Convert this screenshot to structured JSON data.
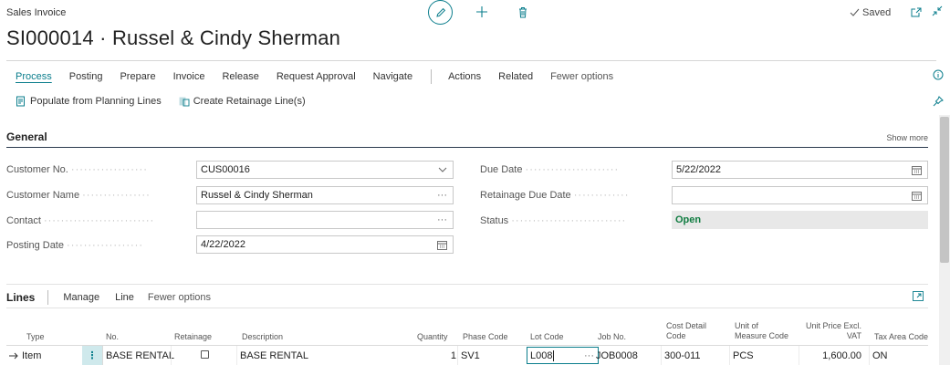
{
  "header": {
    "page_type": "Sales Invoice",
    "title": "SI000014 · Russel & Cindy Sherman",
    "saved_label": "Saved"
  },
  "action_menu": {
    "items": [
      "Process",
      "Posting",
      "Prepare",
      "Invoice",
      "Release",
      "Request Approval",
      "Navigate"
    ],
    "secondary": [
      "Actions",
      "Related",
      "Fewer options"
    ]
  },
  "sub_actions": {
    "populate": "Populate from Planning Lines",
    "retainage": "Create Retainage Line(s)"
  },
  "general": {
    "title": "General",
    "show_more": "Show more",
    "left_fields": [
      {
        "label": "Customer No.",
        "value": "CUS00016"
      },
      {
        "label": "Customer Name",
        "value": "Russel & Cindy Sherman"
      },
      {
        "label": "Contact",
        "value": ""
      },
      {
        "label": "Posting Date",
        "value": "4/22/2022"
      }
    ],
    "right_fields": [
      {
        "label": "Due Date",
        "value": "5/22/2022"
      },
      {
        "label": "Retainage Due Date",
        "value": ""
      },
      {
        "label": "Status",
        "value": "Open"
      }
    ]
  },
  "lines": {
    "title": "Lines",
    "menu": [
      "Manage",
      "Line",
      "Fewer options"
    ],
    "columns": {
      "type": "Type",
      "no": "No.",
      "retainage": "Retainage",
      "description": "Description",
      "quantity": "Quantity",
      "phase_code": "Phase Code",
      "lot_code": "Lot Code",
      "job_no": "Job No.",
      "cost_detail_1": "Cost Detail",
      "cost_detail_2": "Code",
      "uom_1": "Unit of",
      "uom_2": "Measure Code",
      "price_1": "Unit Price Excl.",
      "price_2": "VAT",
      "tax_area": "Tax Area Code"
    },
    "row": {
      "type": "Item",
      "no": "BASE RENTAL",
      "description": "BASE RENTAL",
      "quantity": "1",
      "phase_code": "SV1",
      "lot_code": "L008",
      "job_no": "JOB0008",
      "cost_detail": "300-011",
      "uom": "PCS",
      "unit_price": "1,600.00",
      "tax_area": "ON"
    }
  },
  "colors": {
    "accent": "#0a7d8c",
    "status_green": "#107c41"
  }
}
